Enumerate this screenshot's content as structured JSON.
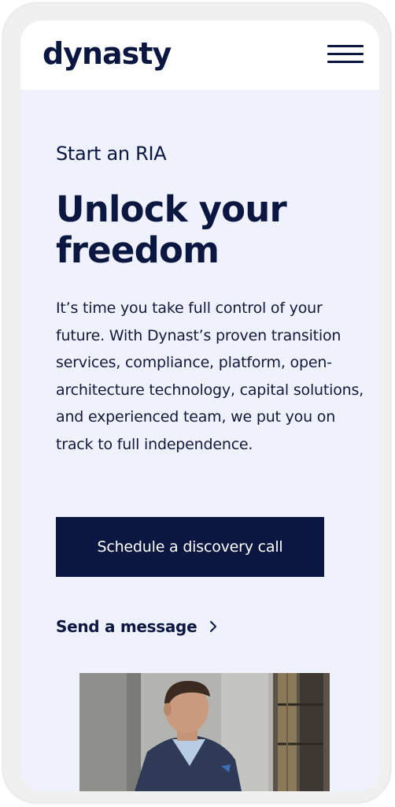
{
  "header": {
    "logo_text": "dynasty",
    "menu_icon": "hamburger-menu-icon"
  },
  "hero": {
    "eyebrow": "Start an RIA",
    "headline": "Unlock your freedom",
    "body": "It’s time you take full control of your future. With Dynast’s proven transition services, compliance, platform, open-architecture technology, capital solutions, and experienced team, we put you on track to full independence.",
    "primary_cta": "Schedule a discovery call",
    "secondary_cta": "Send a message",
    "secondary_cta_icon": "chevron-right-icon"
  },
  "colors": {
    "navy": "#0b1740",
    "background": "#eff2fd",
    "header_bg": "#ffffff"
  }
}
